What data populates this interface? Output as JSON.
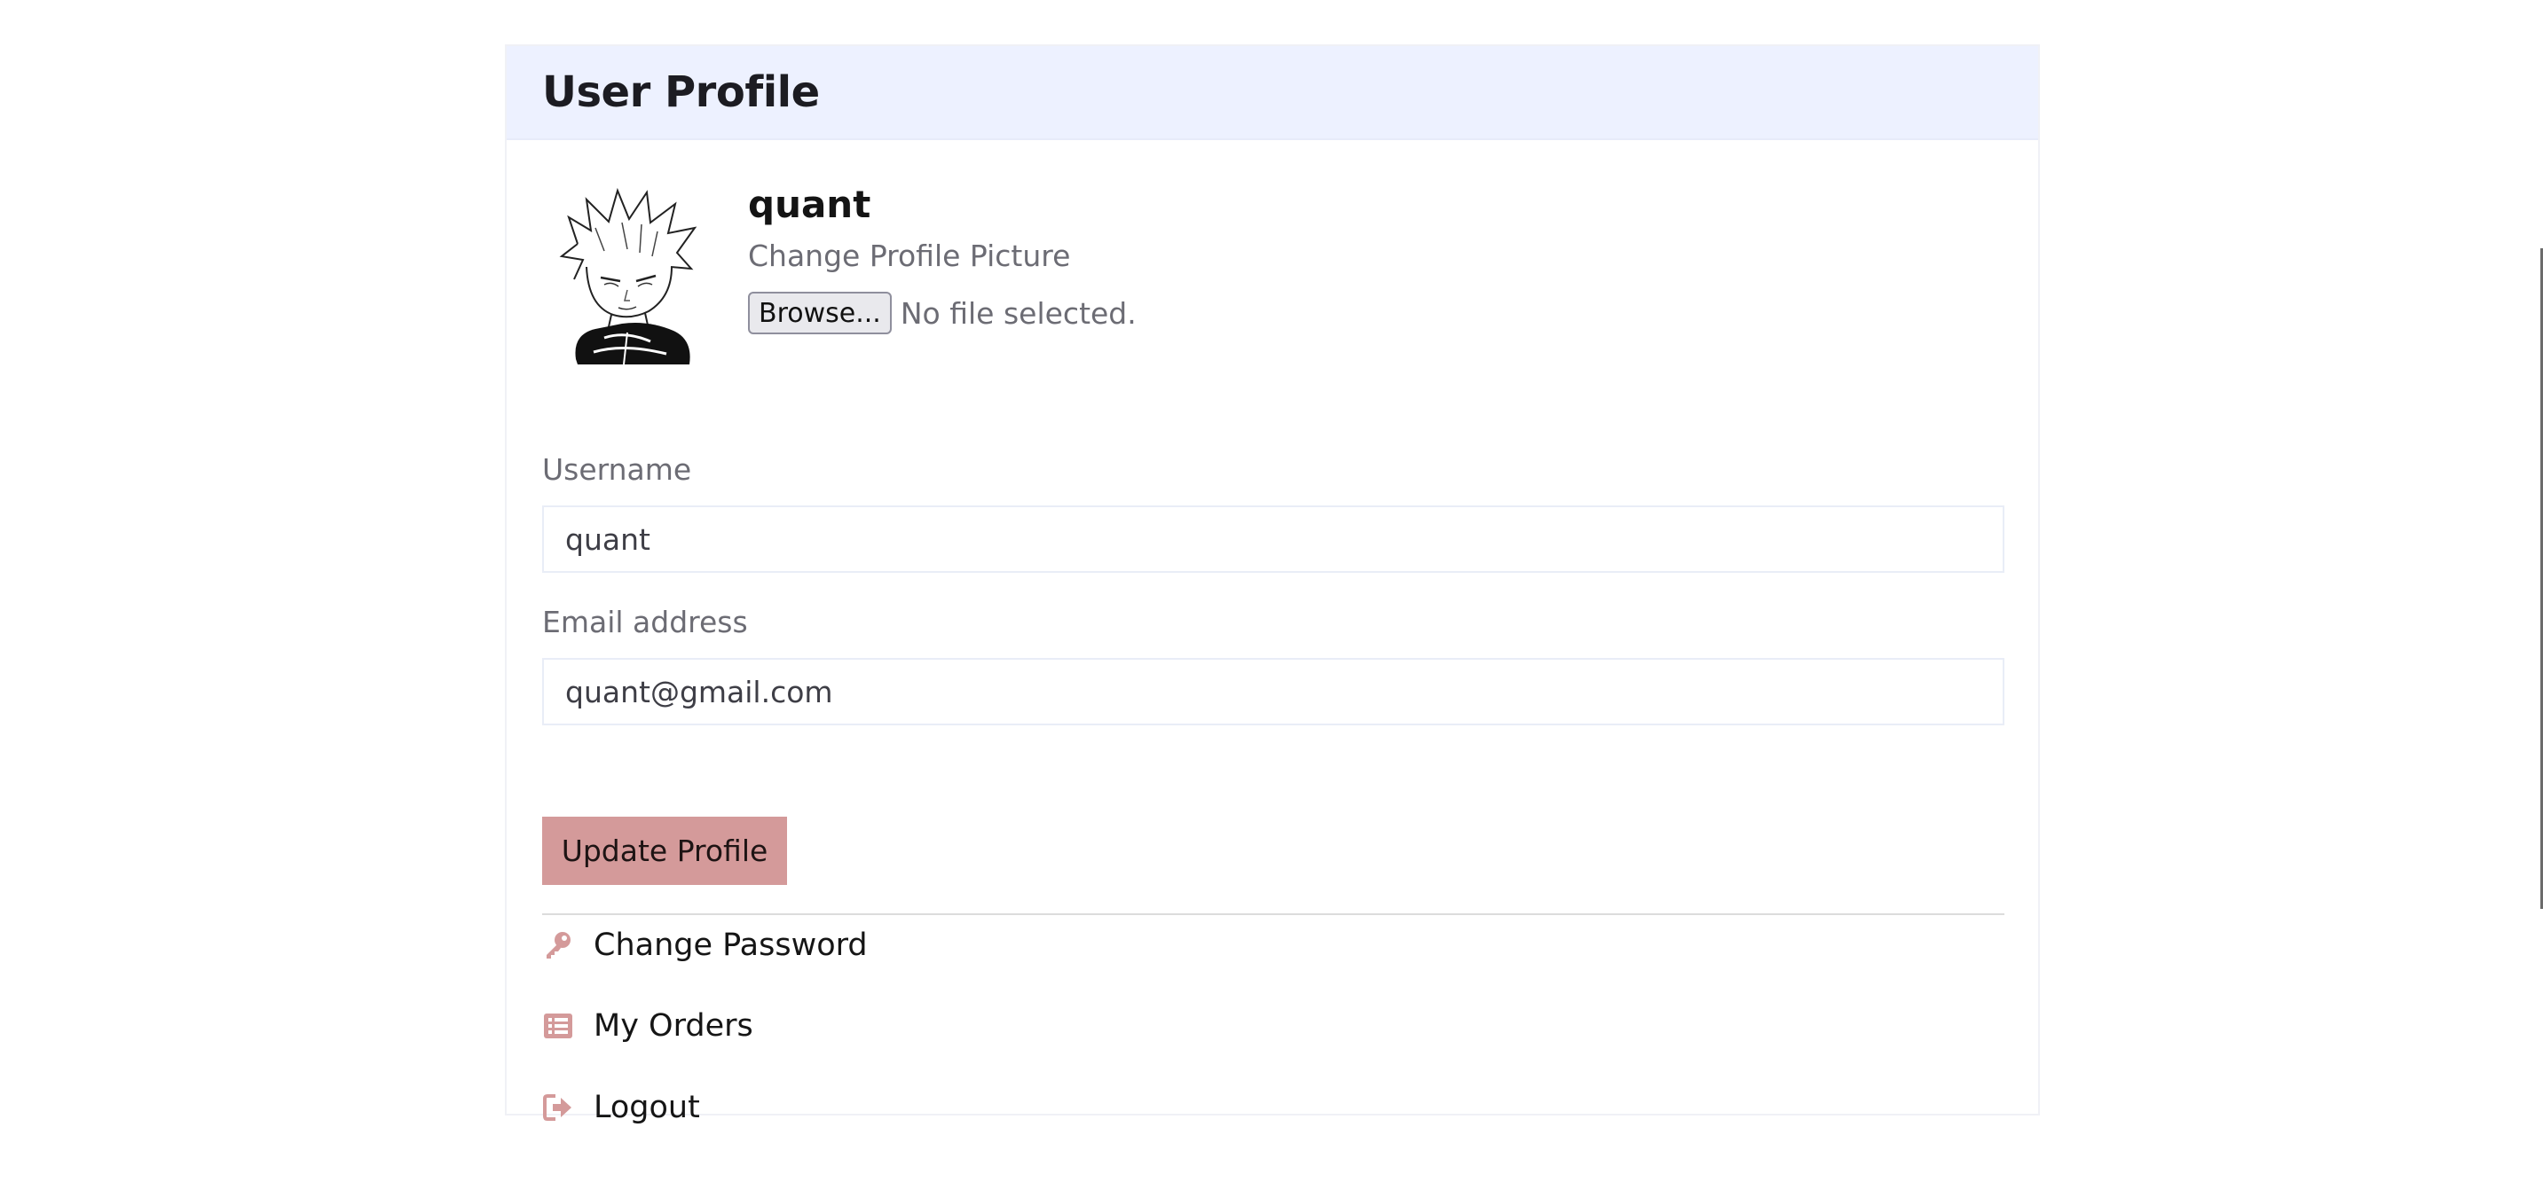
{
  "header": {
    "title": "User Profile"
  },
  "profile": {
    "display_name": "quant",
    "change_picture_label": "Change Profile Picture",
    "browse_label": "Browse...",
    "file_status": "No file selected."
  },
  "form": {
    "username_label": "Username",
    "username_value": "quant",
    "email_label": "Email address",
    "email_value": "quant@gmail.com",
    "update_label": "Update Profile"
  },
  "menu": {
    "items": [
      {
        "label": "Change Password",
        "icon": "key-icon"
      },
      {
        "label": "My Orders",
        "icon": "list-icon"
      },
      {
        "label": "Logout",
        "icon": "logout-icon"
      }
    ]
  },
  "colors": {
    "header_bg": "#edf1ff",
    "accent": "#d49a9a"
  }
}
